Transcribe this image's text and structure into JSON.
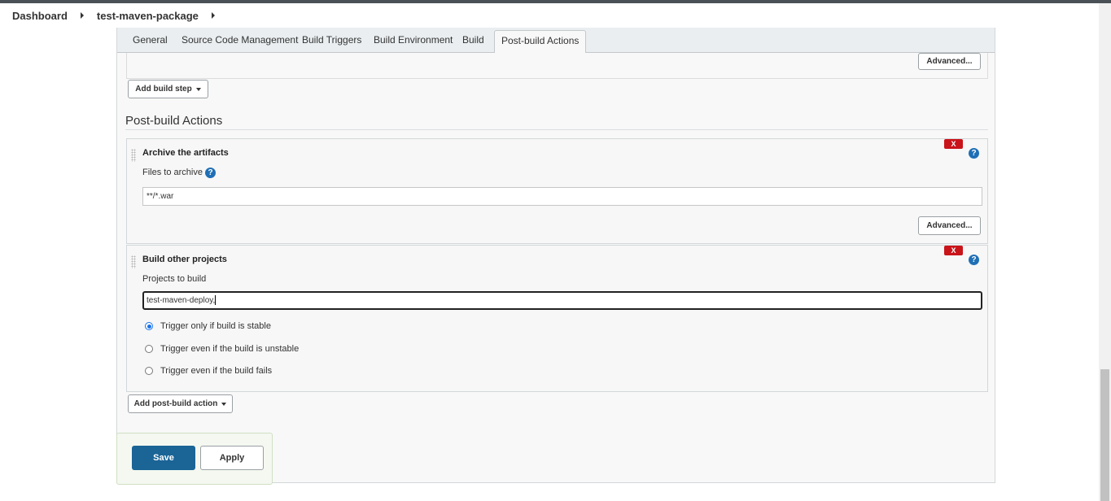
{
  "breadcrumb": {
    "items": [
      "Dashboard",
      "test-maven-package"
    ]
  },
  "tabs": [
    "General",
    "Source Code Management",
    "Build Triggers",
    "Build Environment",
    "Build",
    "Post-build Actions"
  ],
  "active_tab": "Post-build Actions",
  "build_section": {
    "advanced_label": "Advanced...",
    "add_step_label": "Add build step"
  },
  "post_build": {
    "title": "Post-build Actions",
    "archive": {
      "title": "Archive the artifacts",
      "delete_label": "X",
      "help_label": "?",
      "files_label": "Files to archive",
      "files_value": "**/*.war",
      "advanced_label": "Advanced..."
    },
    "build_other": {
      "title": "Build other projects",
      "delete_label": "X",
      "help_label": "?",
      "projects_label": "Projects to build",
      "projects_value": "test-maven-deploy,",
      "options": [
        {
          "label": "Trigger only if build is stable",
          "checked": true
        },
        {
          "label": "Trigger even if the build is unstable",
          "checked": false
        },
        {
          "label": "Trigger even if the build fails",
          "checked": false
        }
      ]
    },
    "add_action_label": "Add post-build action"
  },
  "actions": {
    "save_label": "Save",
    "apply_label": "Apply"
  },
  "colors": {
    "save_button": "#1a6496",
    "delete_button": "#c9141a",
    "help_icon": "#1f6fb5"
  }
}
